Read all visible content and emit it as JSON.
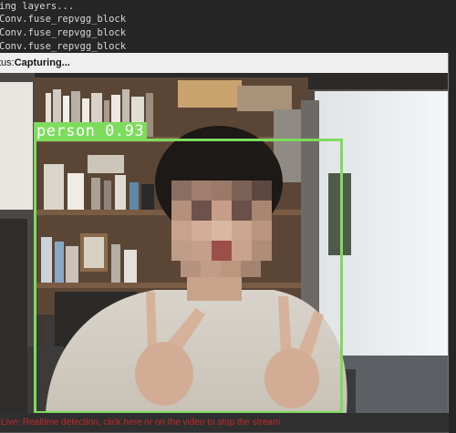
{
  "terminal": {
    "lines": [
      "ing layers...",
      "Conv.fuse_repvgg_block",
      "Conv.fuse_repvgg_block",
      "Conv.fuse_repvgg_block"
    ]
  },
  "window": {
    "status_label": "tus:",
    "status_value": "Capturing..."
  },
  "detection": {
    "label": "person 0.93",
    "class": "person",
    "confidence": 0.93,
    "box_color": "#7ddc5c"
  },
  "bottom_message": "Live: Realtime detection, click here or on the video to stop the stream"
}
